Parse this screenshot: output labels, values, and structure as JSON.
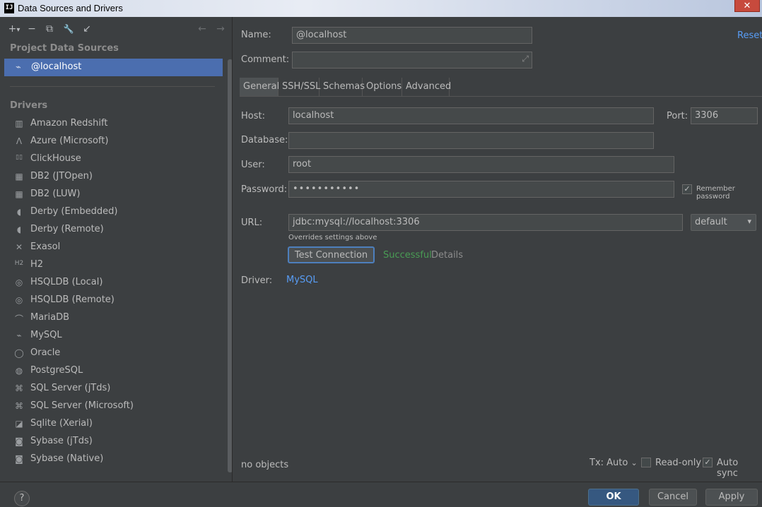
{
  "window": {
    "title": "Data Sources and Drivers",
    "app_icon": "IJ",
    "close_glyph": "✕"
  },
  "left": {
    "toolbar": {
      "add": "+",
      "add_caret": "▾",
      "remove": "−",
      "duplicate": "⧉",
      "settings": "🔧",
      "import": "↙",
      "back": "←",
      "forward": "→"
    },
    "project_header": "Project Data Sources",
    "selected_source": "@localhost",
    "drivers_header": "Drivers",
    "drivers": [
      {
        "label": "Amazon Redshift",
        "icon": "redshift-icon",
        "glyph": "▥"
      },
      {
        "label": "Azure (Microsoft)",
        "icon": "azure-icon",
        "glyph": "Λ"
      },
      {
        "label": "ClickHouse",
        "icon": "clickhouse-icon",
        "glyph": "▯▯"
      },
      {
        "label": "DB2 (JTOpen)",
        "icon": "db2-icon",
        "glyph": "▦"
      },
      {
        "label": "DB2 (LUW)",
        "icon": "db2-icon",
        "glyph": "▦"
      },
      {
        "label": "Derby (Embedded)",
        "icon": "derby-icon",
        "glyph": "◖"
      },
      {
        "label": "Derby (Remote)",
        "icon": "derby-icon",
        "glyph": "◖"
      },
      {
        "label": "Exasol",
        "icon": "exasol-icon",
        "glyph": "✕"
      },
      {
        "label": "H2",
        "icon": "h2-icon",
        "glyph": "H2"
      },
      {
        "label": "HSQLDB (Local)",
        "icon": "hsqldb-icon",
        "glyph": "◎"
      },
      {
        "label": "HSQLDB (Remote)",
        "icon": "hsqldb-icon",
        "glyph": "◎"
      },
      {
        "label": "MariaDB",
        "icon": "mariadb-icon",
        "glyph": "⌒"
      },
      {
        "label": "MySQL",
        "icon": "mysql-icon",
        "glyph": "⌁"
      },
      {
        "label": "Oracle",
        "icon": "oracle-icon",
        "glyph": "◯"
      },
      {
        "label": "PostgreSQL",
        "icon": "postgresql-icon",
        "glyph": "◍"
      },
      {
        "label": "SQL Server (jTds)",
        "icon": "sqlserver-icon",
        "glyph": "⌘"
      },
      {
        "label": "SQL Server (Microsoft)",
        "icon": "sqlserver-icon",
        "glyph": "⌘"
      },
      {
        "label": "Sqlite (Xerial)",
        "icon": "sqlite-icon",
        "glyph": "◪"
      },
      {
        "label": "Sybase (jTds)",
        "icon": "sybase-icon",
        "glyph": "◙"
      },
      {
        "label": "Sybase (Native)",
        "icon": "sybase-icon",
        "glyph": "◙"
      }
    ],
    "help": "?"
  },
  "form": {
    "name_label": "Name:",
    "name_value": "@localhost",
    "comment_label": "Comment:",
    "comment_value": "",
    "expand_glyph": "⤢",
    "reset": "Reset",
    "tabs": [
      "General",
      "SSH/SSL",
      "Schemas",
      "Options",
      "Advanced"
    ],
    "active_tab": "General",
    "host_label": "Host:",
    "host_value": "localhost",
    "port_label": "Port:",
    "port_value": "3306",
    "database_label": "Database:",
    "database_value": "",
    "user_label": "User:",
    "user_value": "root",
    "password_label": "Password:",
    "password_value": "•••••••••••",
    "remember_label": "Remember password",
    "remember_checked": "✓",
    "url_label": "URL:",
    "url_value": "jdbc:mysql://localhost:3306",
    "url_mode": "default",
    "url_mode_caret": "▾",
    "url_note": "Overrides settings above",
    "test_button": "Test Connection",
    "test_status": "Successful",
    "test_details": "Details",
    "driver_label": "Driver:",
    "driver_value": "MySQL",
    "objects_status": "no objects",
    "tx_label": "Tx: Auto",
    "tx_caret": "⌄",
    "readonly_label": "Read-only",
    "readonly_checked": "",
    "autosync_label": "Auto sync",
    "autosync_checked": "✓"
  },
  "buttons": {
    "ok": "OK",
    "cancel": "Cancel",
    "apply": "Apply"
  },
  "colors": {
    "selection": "#4b6eaf",
    "link": "#589df6",
    "success": "#499c54",
    "primary": "#365880"
  }
}
